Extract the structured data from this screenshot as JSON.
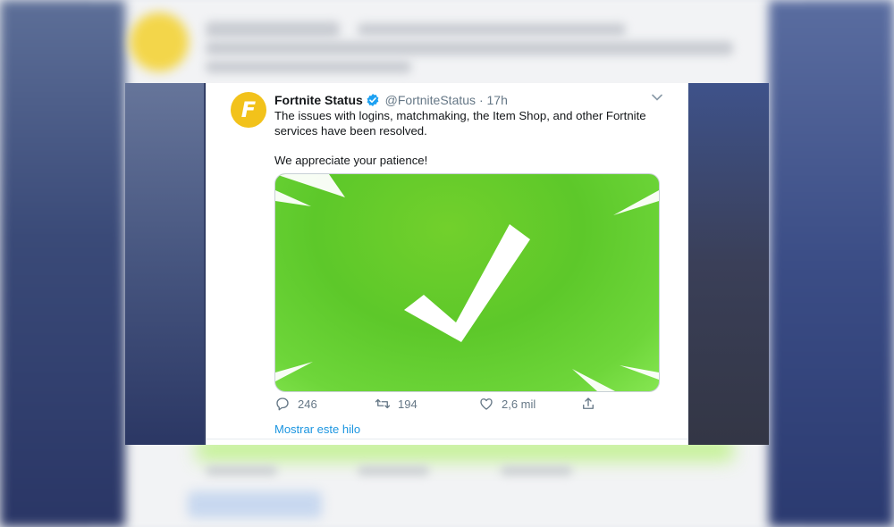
{
  "tweet": {
    "display_name": "Fortnite Status",
    "handle": "@FortniteStatus",
    "separator": "·",
    "time": "17h",
    "text_line1": "The issues with logins, matchmaking, the Item Shop, and other Fortnite services have been resolved.",
    "text_line2": "We appreciate your patience!",
    "avatar_letter": "F",
    "media_icon": "checkmark-icon"
  },
  "actions": {
    "replies": "246",
    "retweets": "194",
    "likes": "2,6 mil"
  },
  "thread_link": "Mostrar este hilo",
  "colors": {
    "accent": "#1b95e0",
    "verified": "#1da1f2",
    "media_green": "#5dc82a",
    "avatar_yellow": "#f2c21b"
  }
}
